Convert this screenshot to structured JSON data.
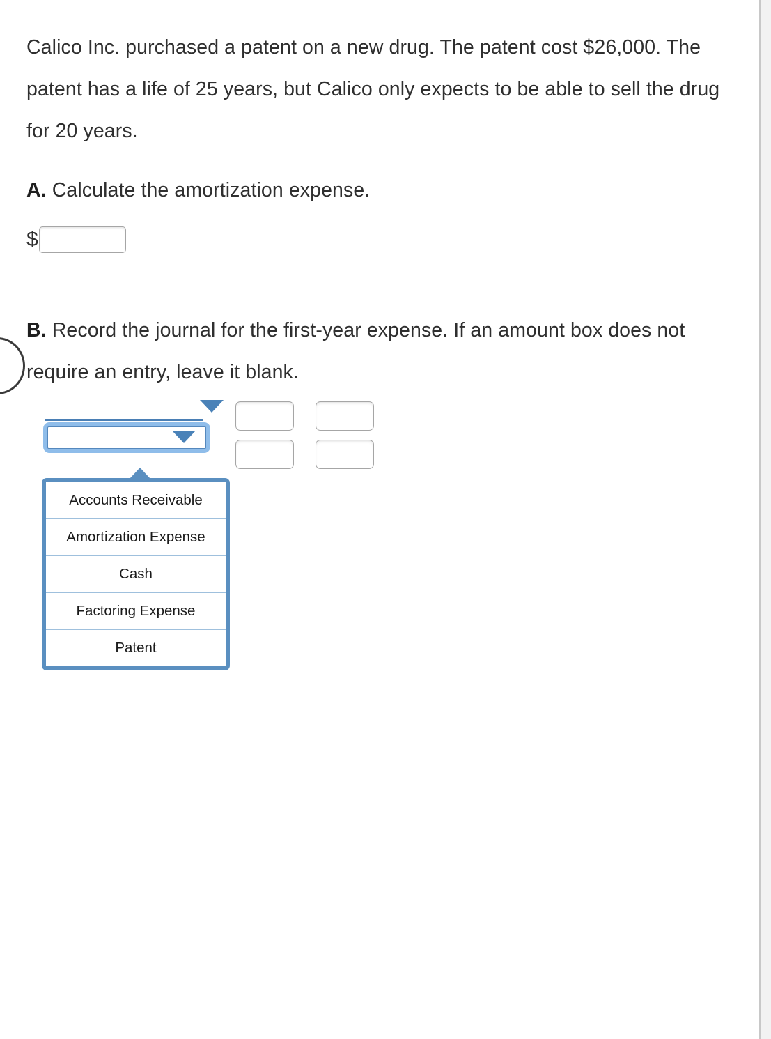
{
  "question": {
    "intro": "Calico Inc. purchased a patent on a new drug. The patent cost $26,000. The patent has a life of 25 years, but Calico only expects to be able to sell the drug for 20 years.",
    "part_a": {
      "letter": "A.",
      "text": " Calculate the amortization expense.",
      "currency_symbol": "$",
      "answer_value": "",
      "answer_placeholder": ""
    },
    "part_b": {
      "letter": "B.",
      "text": " Record the journal for the first-year expense. If an amount box does not require an entry, leave it blank."
    }
  },
  "journal": {
    "account_select_top": {
      "value": "",
      "arrow_icon": "chevron-down-icon"
    },
    "account_select_focused": {
      "value": "",
      "arrow_icon": "chevron-down-icon",
      "focused": true,
      "expanded": true
    },
    "options": [
      "Accounts Receivable",
      "Amortization Expense",
      "Cash",
      "Factoring Expense",
      "Patent"
    ],
    "amount_boxes": [
      {
        "name": "debit-row-1",
        "value": "",
        "placeholder": ""
      },
      {
        "name": "credit-row-1",
        "value": "",
        "placeholder": ""
      },
      {
        "name": "debit-row-2",
        "value": "",
        "placeholder": ""
      },
      {
        "name": "credit-row-2",
        "value": "",
        "placeholder": ""
      }
    ]
  },
  "colors": {
    "focus_ring": "#8fbdea",
    "dropdown_border": "#5a8fc0",
    "arrow": "#4a82b8",
    "text": "#2f2f2f",
    "field_border": "#a6a6a6"
  }
}
